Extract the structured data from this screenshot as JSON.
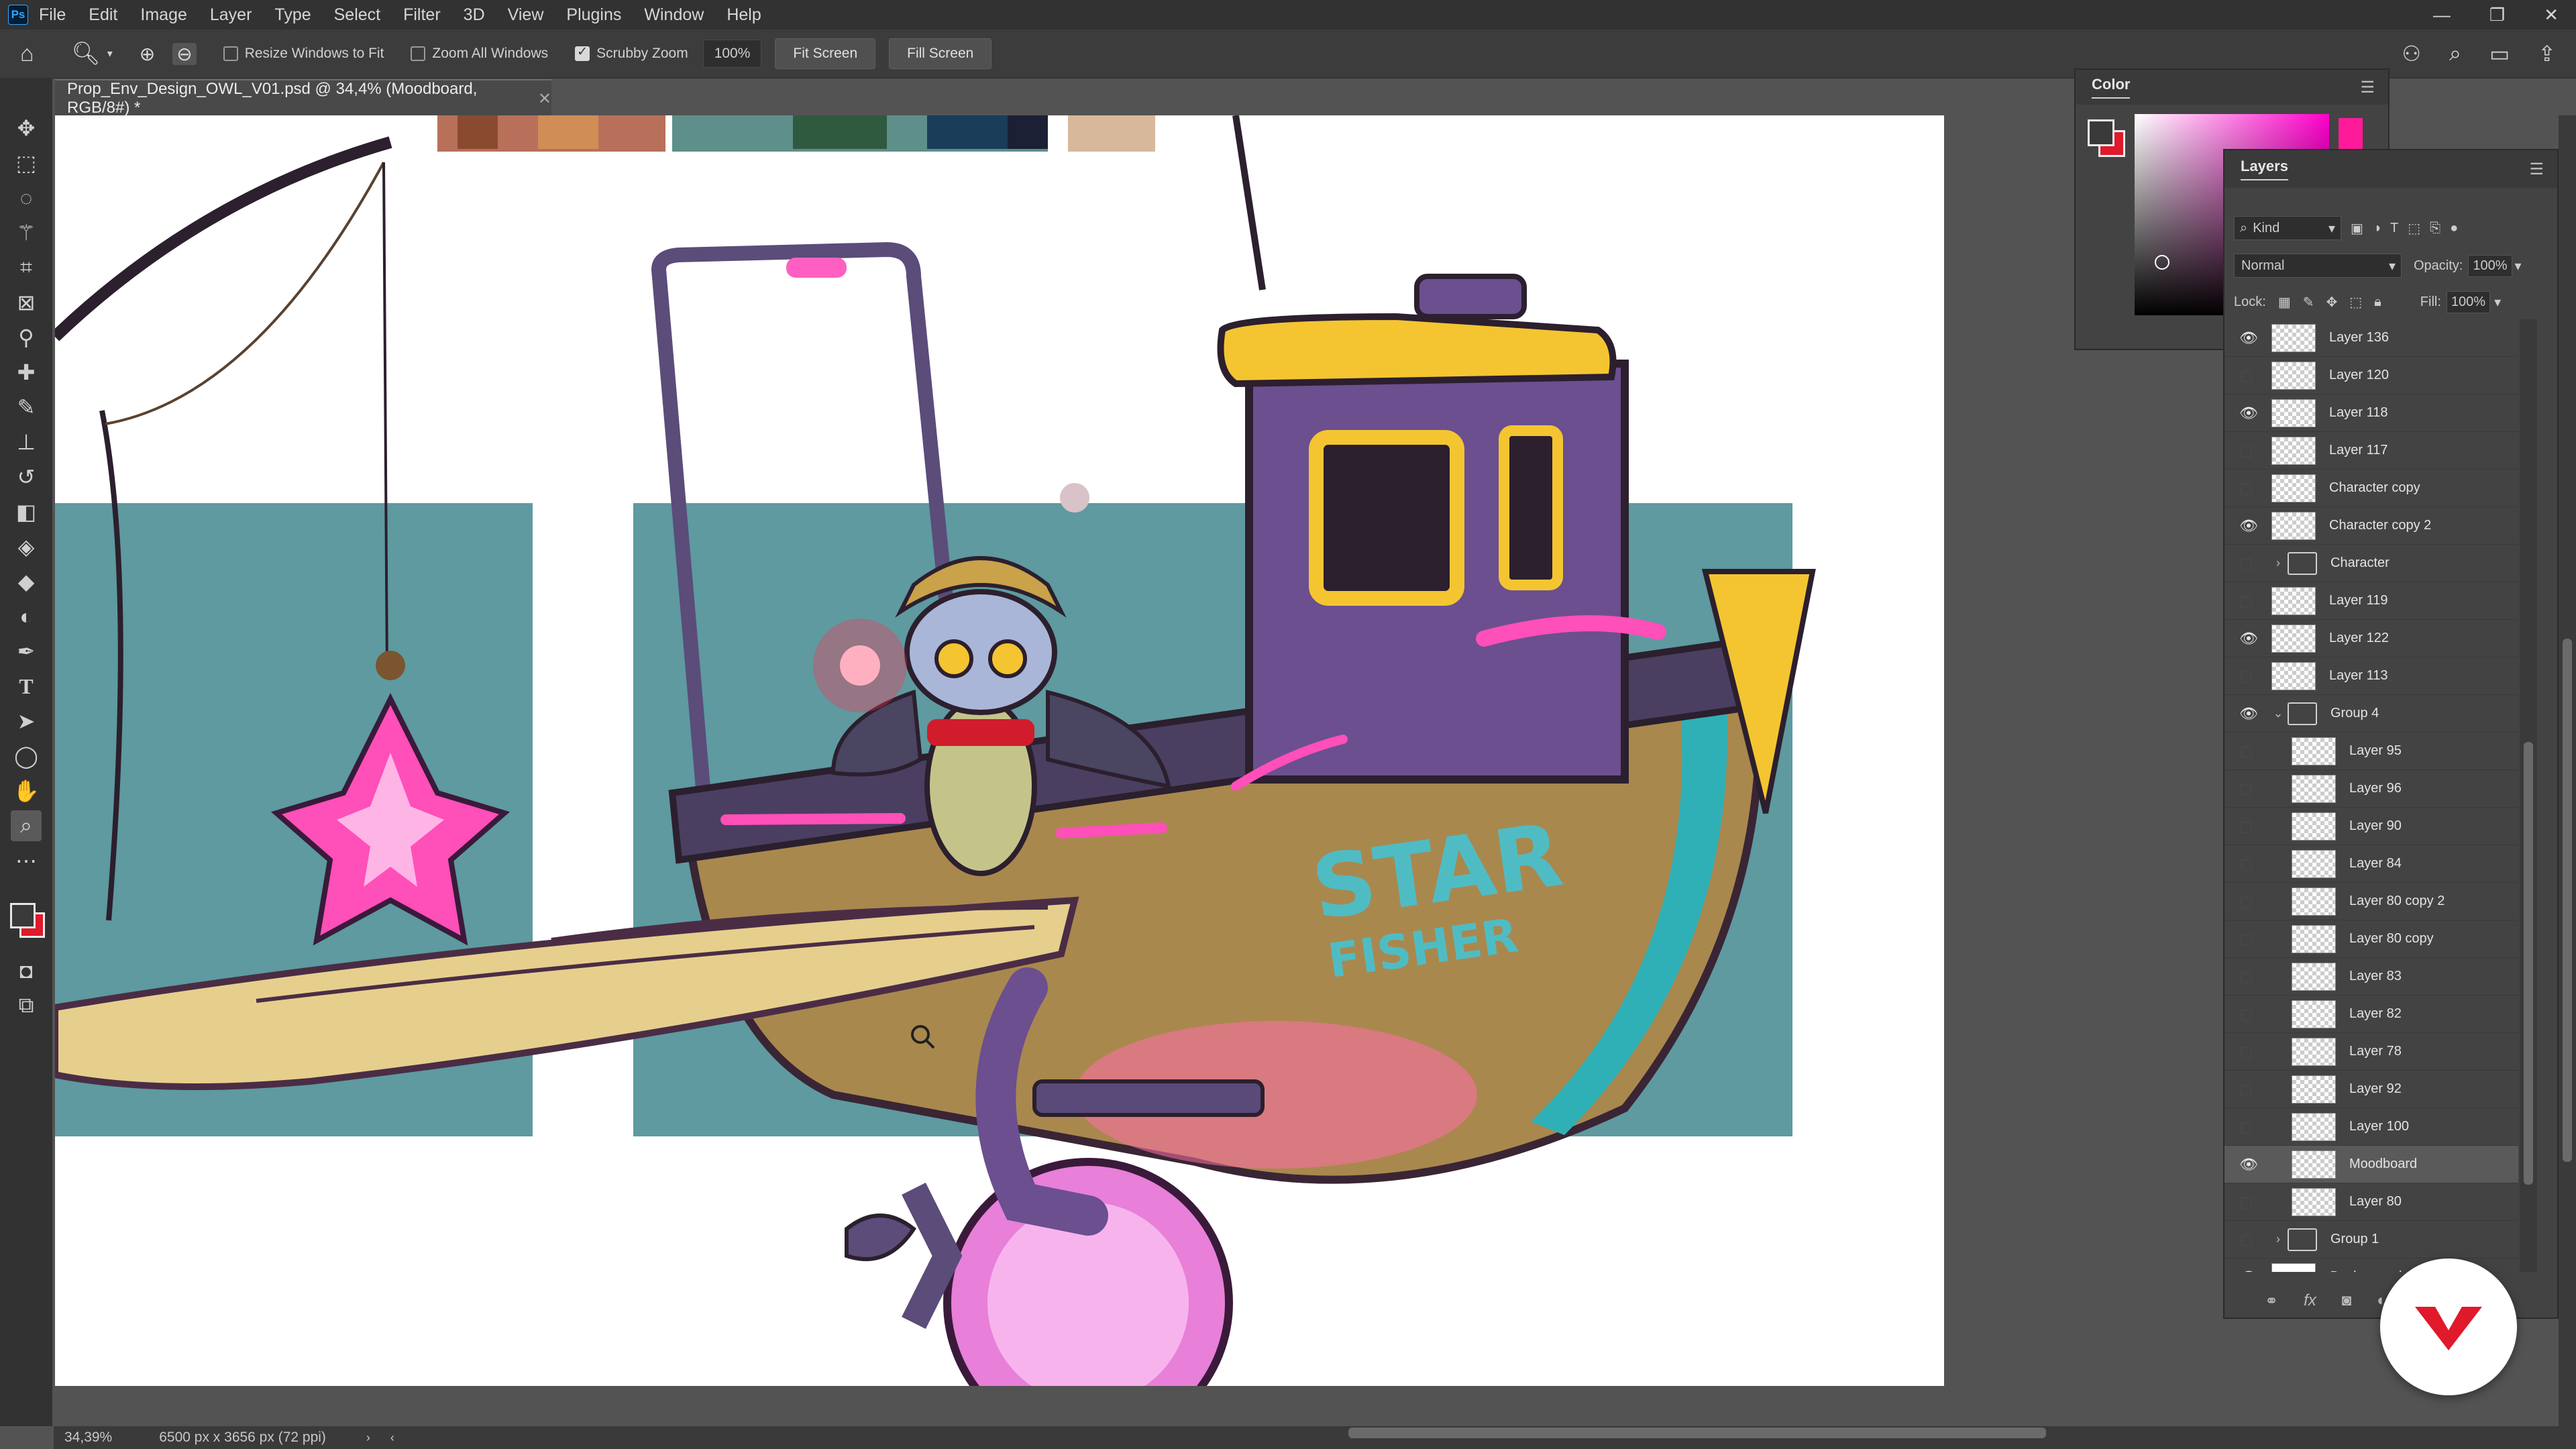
{
  "menubar": {
    "app_logo": "Ps",
    "items": [
      "File",
      "Edit",
      "Image",
      "Layer",
      "Type",
      "Select",
      "Filter",
      "3D",
      "View",
      "Plugins",
      "Window",
      "Help"
    ],
    "window_controls": [
      "minimize",
      "restore",
      "close"
    ]
  },
  "options": {
    "resize_windows": "Resize Windows to Fit",
    "resize_windows_checked": false,
    "zoom_all_windows": "Zoom All Windows",
    "zoom_all_checked": false,
    "scrubby_zoom": "Scrubby Zoom",
    "scrubby_checked": true,
    "zoom_value": "100%",
    "fit_screen": "Fit Screen",
    "fill_screen": "Fill Screen"
  },
  "document": {
    "tab_title": "Prop_Env_Design_OWL_V01.psd @ 34,4% (Moodboard, RGB/8#) *",
    "boat_text_line1": "STAR",
    "boat_text_line2": "FISHER"
  },
  "status": {
    "zoom": "34,39%",
    "doc_size": "6500 px x 3656 px (72 ppi)"
  },
  "color_panel": {
    "title": "Color",
    "fg_color": "#3a3a3a",
    "bg_color": "#e0192b",
    "hue_color": "#ff00cc"
  },
  "layers_panel": {
    "title": "Layers",
    "filter_kind": "Kind",
    "blend_mode": "Normal",
    "opacity_label": "Opacity:",
    "opacity_value": "100%",
    "lock_label": "Lock:",
    "fill_label": "Fill:",
    "fill_value": "100%",
    "layers": [
      {
        "name": "Layer 136",
        "visible": true,
        "indent": 0,
        "type": "layer"
      },
      {
        "name": "Layer 120",
        "visible": false,
        "indent": 0,
        "type": "layer"
      },
      {
        "name": "Layer 118",
        "visible": true,
        "indent": 0,
        "type": "layer"
      },
      {
        "name": "Layer 117",
        "visible": false,
        "indent": 0,
        "type": "layer"
      },
      {
        "name": "Character copy",
        "visible": false,
        "indent": 0,
        "type": "layer"
      },
      {
        "name": "Character copy 2",
        "visible": true,
        "indent": 0,
        "type": "layer"
      },
      {
        "name": "Character",
        "visible": false,
        "indent": 0,
        "type": "group",
        "caret": "›"
      },
      {
        "name": "Layer 119",
        "visible": false,
        "indent": 0,
        "type": "layer"
      },
      {
        "name": "Layer 122",
        "visible": true,
        "indent": 0,
        "type": "layer"
      },
      {
        "name": "Layer 113",
        "visible": false,
        "indent": 0,
        "type": "layer"
      },
      {
        "name": "Group 4",
        "visible": true,
        "indent": 0,
        "type": "group",
        "caret": "⌄"
      },
      {
        "name": "Layer 95",
        "visible": false,
        "indent": 1,
        "type": "layer"
      },
      {
        "name": "Layer 96",
        "visible": false,
        "indent": 1,
        "type": "layer"
      },
      {
        "name": "Layer 90",
        "visible": false,
        "indent": 1,
        "type": "layer"
      },
      {
        "name": "Layer 84",
        "visible": false,
        "indent": 1,
        "type": "layer"
      },
      {
        "name": "Layer 80 copy 2",
        "visible": false,
        "indent": 1,
        "type": "layer"
      },
      {
        "name": "Layer 80 copy",
        "visible": false,
        "indent": 1,
        "type": "layer"
      },
      {
        "name": "Layer 83",
        "visible": false,
        "indent": 1,
        "type": "layer"
      },
      {
        "name": "Layer 82",
        "visible": false,
        "indent": 1,
        "type": "layer"
      },
      {
        "name": "Layer 78",
        "visible": false,
        "indent": 1,
        "type": "layer"
      },
      {
        "name": "Layer 92",
        "visible": false,
        "indent": 1,
        "type": "layer"
      },
      {
        "name": "Layer 100",
        "visible": false,
        "indent": 1,
        "type": "layer"
      },
      {
        "name": "Moodboard",
        "visible": true,
        "indent": 1,
        "type": "layer",
        "selected": true
      },
      {
        "name": "Layer 80",
        "visible": false,
        "indent": 1,
        "type": "layer"
      },
      {
        "name": "Group 1",
        "visible": false,
        "indent": 0,
        "type": "group",
        "caret": "›"
      },
      {
        "name": "Background",
        "visible": true,
        "indent": 0,
        "type": "background",
        "italic": true,
        "locked": true
      }
    ]
  },
  "tools": [
    "move-tool",
    "marquee-tool",
    "lasso-tool",
    "magic-wand-tool",
    "crop-tool",
    "frame-tool",
    "eyedropper-tool",
    "healing-brush-tool",
    "brush-tool",
    "stamp-tool",
    "history-brush-tool",
    "eraser-tool",
    "paint-bucket-tool",
    "blur-tool",
    "dodge-tool",
    "pen-tool",
    "type-tool",
    "path-selection-tool",
    "shape-tool",
    "hand-tool",
    "zoom-tool",
    "more-tools"
  ],
  "colors": {
    "teal_backdrop": "#5e9aa0",
    "boat_purple": "#6b4f8f",
    "boat_wood": "#a9884e",
    "cabin_yellow": "#f4c531",
    "neon_pink": "#ff3eb5",
    "brand_red": "#e0192b"
  }
}
